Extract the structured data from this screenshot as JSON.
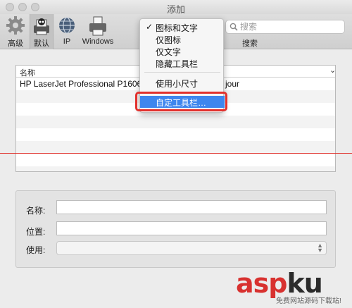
{
  "window": {
    "title": "添加",
    "traffic_color": "#cfcfcf"
  },
  "toolbar": {
    "items": [
      {
        "label": "高级",
        "icon": "gear-icon"
      },
      {
        "label": "默认",
        "icon": "default-printer-icon",
        "selected": true
      },
      {
        "label": "IP",
        "icon": "globe-icon"
      },
      {
        "label": "Windows",
        "icon": "printer-icon"
      }
    ],
    "search": {
      "placeholder": "搜索",
      "label": "搜索"
    }
  },
  "context_menu": {
    "items": [
      {
        "label": "图标和文字",
        "checked": true
      },
      {
        "label": "仅图标",
        "checked": false
      },
      {
        "label": "仅文字",
        "checked": false
      },
      {
        "label": "隐藏工具栏",
        "checked": false
      },
      {
        "label": "使用小尺寸",
        "checked": false
      },
      {
        "label": "自定工具栏…",
        "highlighted": true
      }
    ],
    "checkmark": "✓",
    "highlight_color": "#3e86ee",
    "callout_color": "#e2312d"
  },
  "printer_table": {
    "columns": [
      "名称",
      ""
    ],
    "rows": [
      {
        "name": "HP LaserJet Professional P1606dn",
        "kind": "jour"
      }
    ],
    "sort_indicator": "⌄"
  },
  "form": {
    "name_label": "名称:",
    "name_value": "",
    "location_label": "位置:",
    "location_value": "",
    "use_label": "使用:",
    "use_value": ""
  },
  "watermark": {
    "text_a": "asp",
    "text_b": "ku",
    "sub": "免费网站源码下载站!"
  }
}
